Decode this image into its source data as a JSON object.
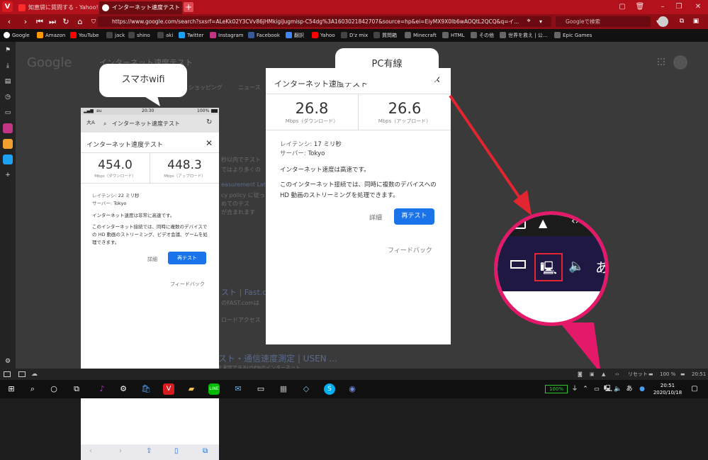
{
  "browser": {
    "tabs": [
      {
        "label": "知恵袋に質問する - Yahoo!知恵袋",
        "active": false
      },
      {
        "label": "インターネット速度テスト - Google 検索",
        "active": true
      }
    ],
    "new_tab_label": "+",
    "url": "https://www.google.com/search?sxsrf=ALeKk02Y3CVv86jHMkigiJugmisp-C54dg%3A1603021842707&source=hp&ei=EiyMX9X0Ib6wAOQtL2QCQ&q=イ...",
    "search_placeholder": "Googleで検索",
    "bookmarks": [
      "Google",
      "Amazon",
      "YouTube",
      "jack",
      "shino",
      "aki",
      "Twitter",
      "Instagram",
      "Facebook",
      "翻訳",
      "Yahoo",
      "D'z mix",
      "質問箱",
      "Minecraft",
      "HTML",
      "その他",
      "世界を救え | 公...",
      "Epic Games"
    ]
  },
  "background_page": {
    "logo": "Google",
    "query": "インターネット速度テスト",
    "tab_shopping": "ショッピング",
    "tab_news": "ニュース",
    "snippet1": "秒以内でテスト",
    "snippet2": "ではより多くの",
    "snippet3": "easurement Lat",
    "snippet4": "cy policy に従っ",
    "snippet5": "めてのテス",
    "snippet6": "が含まれます",
    "result_title": "スト | Fast.c",
    "result_sub": "のFAST.comは",
    "result_sub2": "ロードアクセス",
    "result2_title": "インターネット回線スピードテスト・通信速度測定 | USEN ...",
    "result2_sub": "ダウンロード/アップロードのスピード、ping、jitterを測定できるUSENのインターネット"
  },
  "phone_label": "スマホwifi",
  "phone": {
    "status_left": "au",
    "status_time": "20:30",
    "status_battery": "100%",
    "aa": "大A",
    "address": "インターネット速度テスト",
    "card_title": "インターネット速度テスト",
    "download_value": "454.0",
    "download_unit": "Mbps（ダウンロード）",
    "upload_value": "448.3",
    "upload_unit": "Mbps（アップロード）",
    "latency_label": "レイテンシ:",
    "latency_value": "22 ミリ秒",
    "server_label": "サーバー:",
    "server_value": "Tokyo",
    "status_text": "インターネット速度は非常に高速です。",
    "desc": "このインターネット接続では、同時に複数のデバイスでの HD 動画のストリーミング、ビデオ会議、ゲームを処理できます。",
    "detail_link": "詳細",
    "retest_button": "再テスト",
    "feedback_link": "フィードバック"
  },
  "laptop_label": "PC有線",
  "laptop": {
    "card_title": "インターネット速度テスト",
    "download_value": "26.8",
    "download_unit": "Mbps（ダウンロード）",
    "upload_value": "26.6",
    "upload_unit": "Mbps（アップロード）",
    "latency_label": "レイテンシ:",
    "latency_value": "17 ミリ秒",
    "server_label": "サーバー:",
    "server_value": "Tokyo",
    "status_text": "インターネット速度は高速です。",
    "desc": "このインターネット接続では、同時に複数のデバイスへの HD 動画のストリーミングを処理できます。",
    "detail_link": "詳細",
    "retest_button": "再テスト",
    "feedback_link": "フィードバック"
  },
  "zoom_ime": "あ",
  "taskbar": {
    "reset_label": "リセット",
    "zoom_label": "100 %",
    "top_time": "20:51",
    "battery_label": "100%",
    "ime_label": "あ",
    "clock_time": "20:51",
    "clock_date": "2020/10/18"
  },
  "colors": {
    "vivaldi_red": "#b3121c",
    "google_blue": "#1a73e8",
    "annotation_pink": "#e4196a"
  }
}
